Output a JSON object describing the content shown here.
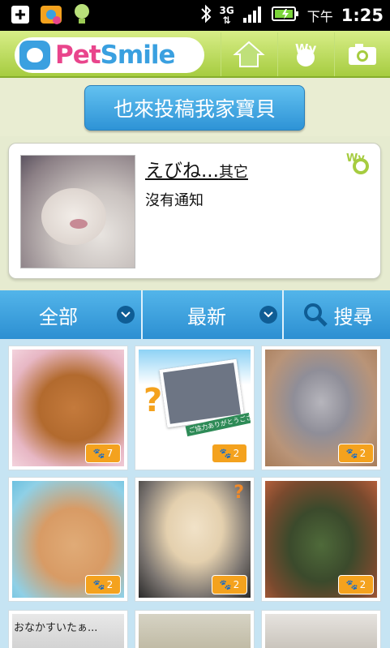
{
  "status_bar": {
    "network": "3G",
    "ampm": "下午",
    "time": "1:25"
  },
  "header": {
    "logo_part1": "Pet",
    "logo_part2": "Smile"
  },
  "post_button_label": "也來投稿我家寶貝",
  "profile": {
    "name": "えびね...",
    "category": "其它",
    "notification": "沒有通知"
  },
  "filters": {
    "category": "全部",
    "sort": "最新",
    "search": "搜尋"
  },
  "grid": {
    "tiles": [
      {
        "count": "7"
      },
      {
        "count": "2"
      },
      {
        "count": "2"
      },
      {
        "count": "2"
      },
      {
        "count": "2"
      },
      {
        "count": "2"
      }
    ],
    "photo2_caption": "ご協力ありがとうございます",
    "photo7_caption": "おなかすいたぁ..."
  },
  "colors": {
    "header_green": "#a6cc40",
    "accent_blue": "#2e93d6",
    "badge_orange": "#f4a21e",
    "logo_pink": "#e9458c"
  }
}
